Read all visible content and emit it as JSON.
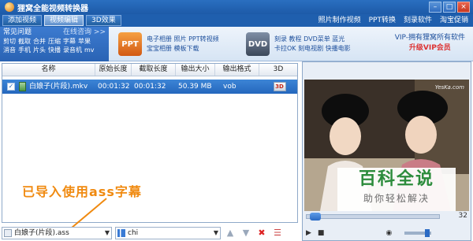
{
  "app": {
    "title": "狸窝全能视频转换器"
  },
  "tabs": [
    "添加视频",
    "视频编辑",
    "3D效果"
  ],
  "top_links": [
    "照片制作视频",
    "PPT转换",
    "刻录软件",
    "淘宝促销"
  ],
  "faq": {
    "title": "常见问题",
    "more": "在线咨询 >>",
    "rows": [
      [
        "剪切",
        "截取",
        "合并",
        "压缩",
        "字幕",
        "苹果"
      ],
      [
        "消音",
        "手机",
        "片头",
        "快播",
        "录音机",
        "mv"
      ]
    ]
  },
  "promos": [
    {
      "icon_label": "PPT",
      "lines": [
        "电子相册 照片 PPT转视频",
        "宝宝相册 模板下载"
      ]
    },
    {
      "icon_label": "DVD",
      "lines": [
        "刻录 教程 DVD菜单 蓝光",
        "卡拉OK 刻电视剧 快播电影"
      ]
    }
  ],
  "vip": {
    "line1": "VIP-拥有狸窝所有软件",
    "line2": "升级VIP会员"
  },
  "table": {
    "columns": [
      "名称",
      "原始长度",
      "截取长度",
      "输出大小",
      "输出格式",
      "3D"
    ],
    "rows": [
      {
        "name": "白娘子(片段).mkv",
        "orig": "00:01:32",
        "cut": "00:01:32",
        "size": "50.39 MB",
        "format": "vob",
        "three_d": "3D"
      }
    ]
  },
  "annotation": "已导入使用ass字幕",
  "bottom": {
    "subtitle_file": "白娘子(片段).ass",
    "audio_track": "chi"
  },
  "preview": {
    "site_watermark": "YesKa.com",
    "baike_line1": "百科全说",
    "baike_line2": "助你轻松解决",
    "timecode": "32"
  }
}
